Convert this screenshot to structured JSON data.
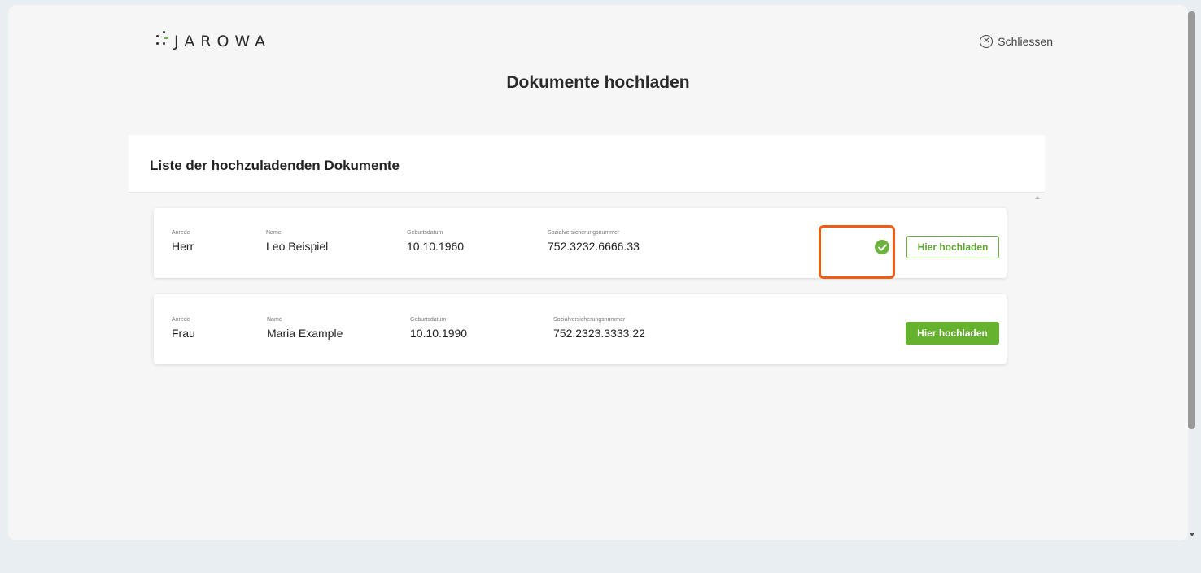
{
  "app": {
    "logo_text": "JAROWA",
    "close_label": "Schliessen",
    "page_title": "Dokumente hochladen"
  },
  "panel": {
    "title": "Liste der hochzuladenden Dokumente"
  },
  "persons": [
    {
      "salutation_label": "Anrede",
      "salutation": "Herr",
      "name_label": "Name",
      "name": "Leo Beispiel",
      "birthdate_label": "Geburtsdatum",
      "birthdate": "10.10.1960",
      "ssn_label": "Sozialversicherungsnummer",
      "ssn": "752.3232.6666.33",
      "upload_label": "Hier hochladen",
      "uploaded": true
    },
    {
      "salutation_label": "Anrede",
      "salutation": "Frau",
      "name_label": "Name",
      "name": "Maria Example",
      "birthdate_label": "Geburtsdatum",
      "birthdate": "10.10.1990",
      "ssn_label": "Sozialversicherungsnummer",
      "ssn": "752.2323.3333.22",
      "upload_label": "Hier hochladen",
      "uploaded": false
    }
  ],
  "colors": {
    "accent_green": "#64b22e",
    "highlight_orange": "#f25b14",
    "background": "#e8eef1"
  },
  "icons": {
    "close": "close-circle-icon",
    "check": "check-circle-icon"
  }
}
